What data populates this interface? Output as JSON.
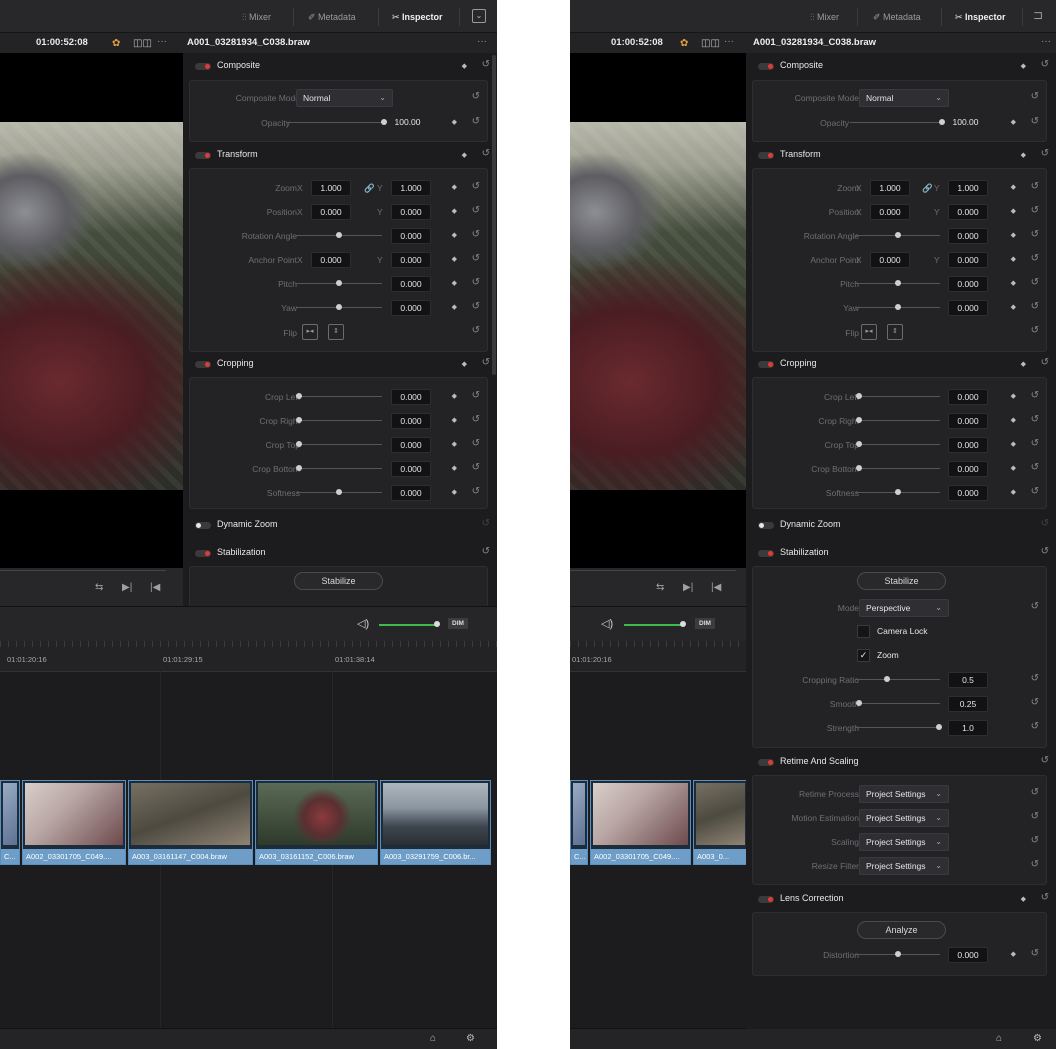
{
  "header": {
    "mixer_label": "Mixer",
    "metadata_label": "Metadata",
    "inspector_label": "Inspector"
  },
  "viewer": {
    "timecode": "01:00:52:08",
    "file_name": "A001_03281934_C038.braw"
  },
  "audio": {
    "dim_label": "DIM"
  },
  "timeline": {
    "ruler_ticks": [
      "01:01:20:16",
      "01:01:29:15",
      "01:01:38:14"
    ],
    "clips": [
      "C...",
      "A002_03301705_C049....",
      "A003_03161147_C004.braw",
      "A003_03161152_C006.braw",
      "A003_03291759_C006.br..."
    ],
    "clips_b": [
      "C...",
      "A002_03301705_C049....",
      "A003_0..."
    ]
  },
  "composite": {
    "title": "Composite",
    "mode_label": "Composite Mode",
    "mode_value": "Normal",
    "opacity_label": "Opacity",
    "opacity_value": "100.00"
  },
  "transform": {
    "title": "Transform",
    "zoom_label": "Zoom",
    "zoom_x": "1.000",
    "zoom_y": "1.000",
    "position_label": "Position",
    "position_x": "0.000",
    "position_y": "0.000",
    "rotation_label": "Rotation Angle",
    "rotation_value": "0.000",
    "anchor_label": "Anchor Point",
    "anchor_x": "0.000",
    "anchor_y": "0.000",
    "pitch_label": "Pitch",
    "pitch_value": "0.000",
    "yaw_label": "Yaw",
    "yaw_value": "0.000",
    "flip_label": "Flip",
    "x_axis": "X",
    "y_axis": "Y"
  },
  "cropping": {
    "title": "Cropping",
    "left_label": "Crop Left",
    "left_value": "0.000",
    "right_label": "Crop Right",
    "right_value": "0.000",
    "top_label": "Crop Top",
    "top_value": "0.000",
    "bottom_label": "Crop Bottom",
    "bottom_value": "0.000",
    "softness_label": "Softness",
    "softness_value": "0.000"
  },
  "dynamic_zoom": {
    "title": "Dynamic Zoom"
  },
  "stabilization": {
    "title": "Stabilization",
    "stabilize_button": "Stabilize",
    "mode_label": "Mode",
    "mode_value": "Perspective",
    "camera_lock_label": "Camera Lock",
    "zoom_label": "Zoom",
    "zoom_check": "✓",
    "cropping_ratio_label": "Cropping Ratio",
    "cropping_ratio_value": "0.5",
    "smooth_label": "Smooth",
    "smooth_value": "0.25",
    "strength_label": "Strength",
    "strength_value": "1.0"
  },
  "retime": {
    "title": "Retime And Scaling",
    "process_label": "Retime Process",
    "process_value": "Project Settings",
    "motion_label": "Motion Estimation",
    "motion_value": "Project Settings",
    "scaling_label": "Scaling",
    "scaling_value": "Project Settings",
    "resize_label": "Resize Filter",
    "resize_value": "Project Settings"
  },
  "lens": {
    "title": "Lens Correction",
    "analyze_button": "Analyze",
    "distortion_label": "Distortion",
    "distortion_value": "0.000"
  },
  "colors": {
    "accent_red": "#e23a37",
    "clip_blue": "#6e9ec7",
    "volume_green": "#3dbb4f"
  }
}
